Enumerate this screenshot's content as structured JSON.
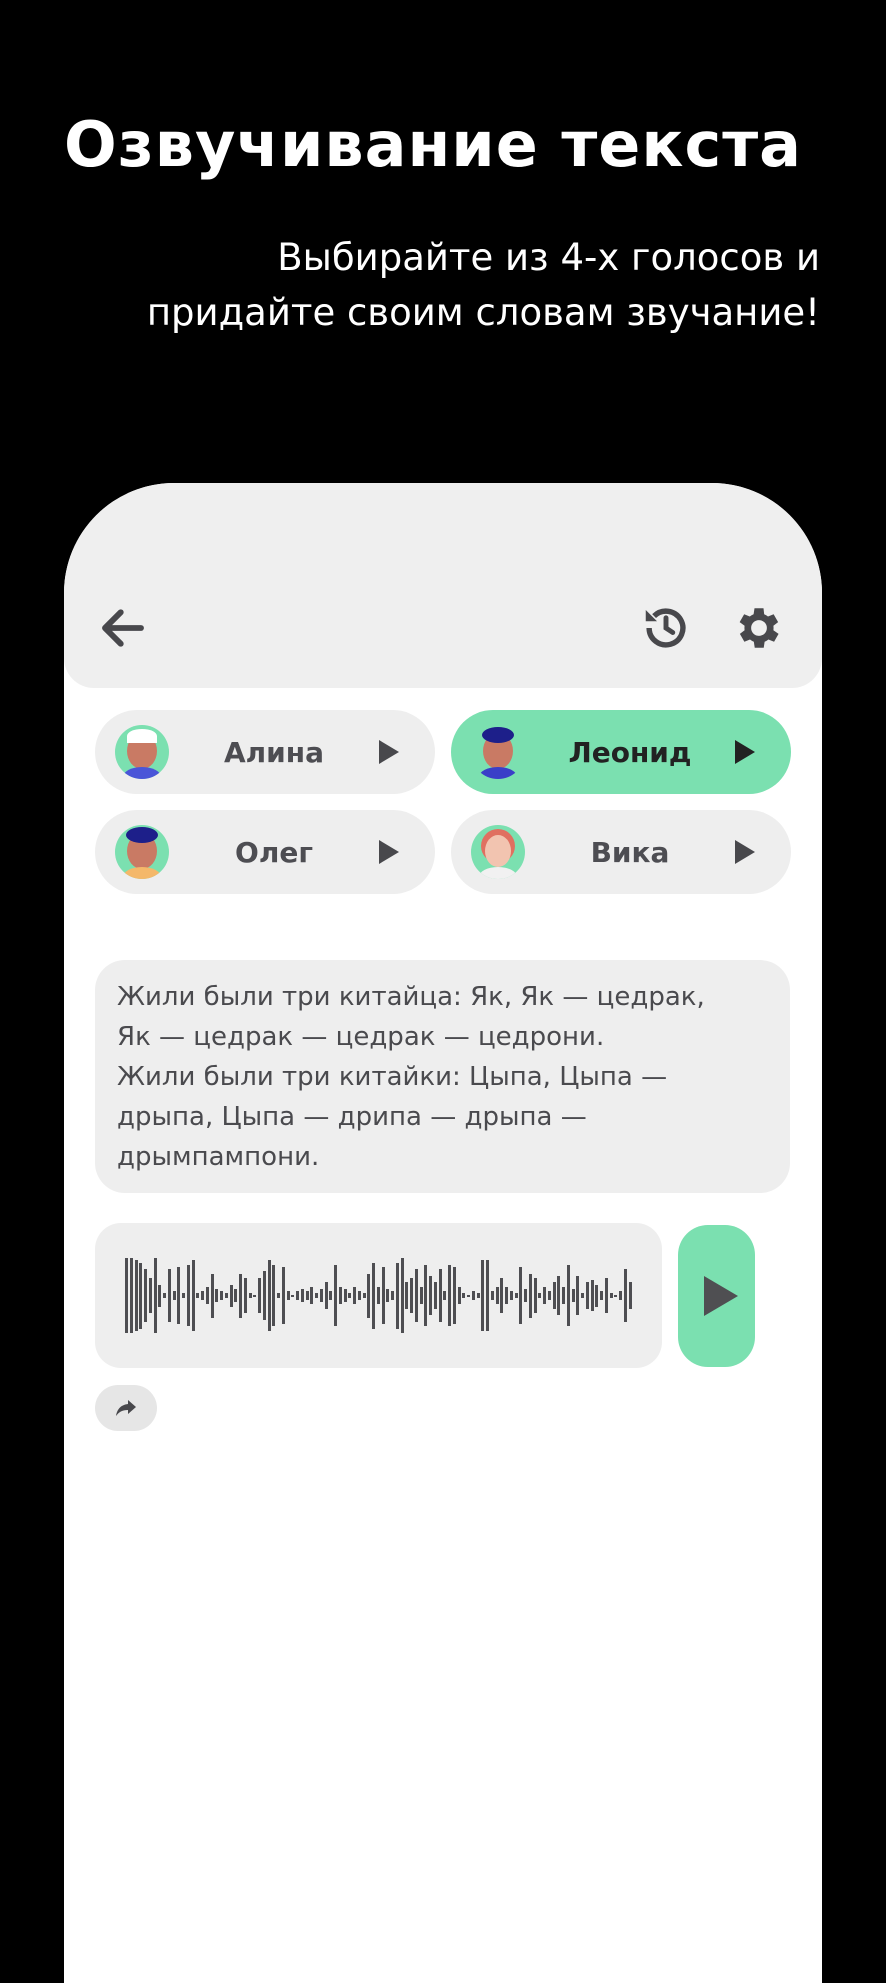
{
  "promo": {
    "title": "Озвучивание текста",
    "subtitle": "Выбирайте из 4-х голосов и придайте своим словам звучание!"
  },
  "header": {
    "icons": [
      "back-arrow-icon",
      "history-icon",
      "gear-icon"
    ]
  },
  "voices": [
    {
      "name": "Алина",
      "selected": false
    },
    {
      "name": "Леонид",
      "selected": true
    },
    {
      "name": "Олег",
      "selected": false
    },
    {
      "name": "Вика",
      "selected": false
    }
  ],
  "text": "Жили были три китайца: Як, Як — цедрак,\nЯк — цедрак — цедрак — цедрони.\nЖили были три китайки: Цыпа, Цыпа —\nдрыпа, Цыпа — дрипа — дрыпа —\nдрымпампони.",
  "waveform": [
    0.85,
    0.85,
    0.8,
    0.75,
    0.6,
    0.4,
    0.85,
    0.25,
    0.05,
    0.6,
    0.1,
    0.65,
    0.05,
    0.7,
    0.8,
    0.05,
    0.1,
    0.2,
    0.5,
    0.15,
    0.1,
    0.05,
    0.25,
    0.15,
    0.5,
    0.4,
    0.05,
    0.02,
    0.4,
    0.55,
    0.8,
    0.7,
    0.05,
    0.65,
    0.1,
    0.02,
    0.1,
    0.15,
    0.1,
    0.2,
    0.05,
    0.15,
    0.3,
    0.1,
    0.7,
    0.2,
    0.15,
    0.05,
    0.2,
    0.1,
    0.05,
    0.5,
    0.75,
    0.2,
    0.65,
    0.15,
    0.1,
    0.75,
    0.85,
    0.3,
    0.4,
    0.6,
    0.2,
    0.7,
    0.45,
    0.3,
    0.6,
    0.1,
    0.7,
    0.65,
    0.2,
    0.05,
    0.02,
    0.1,
    0.05,
    0.8,
    0.8,
    0.1,
    0.2,
    0.4,
    0.2,
    0.1,
    0.05,
    0.65,
    0.15,
    0.5,
    0.4,
    0.05,
    0.2,
    0.1,
    0.3,
    0.45,
    0.2,
    0.7,
    0.15,
    0.45,
    0.05,
    0.3,
    0.35,
    0.25,
    0.1,
    0.4,
    0.05,
    0.02,
    0.1,
    0.6,
    0.3
  ],
  "colors": {
    "accent": "#7be0b0",
    "surface": "#eeeeee",
    "icon": "#4e4e52"
  }
}
